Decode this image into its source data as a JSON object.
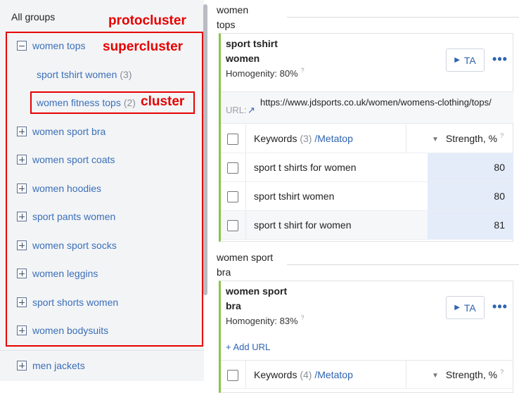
{
  "sidebar": {
    "title": "All groups",
    "labels": {
      "protocluster": "protocluster",
      "supercluster": "supercluster",
      "cluster": "cluster"
    },
    "supercluster": {
      "name": "women tops",
      "icon": "minus-icon"
    },
    "subclusters": [
      {
        "name": "sport tshirt women",
        "count": "(3)"
      },
      {
        "name": "women fitness tops",
        "count": "(2)"
      }
    ],
    "groups": [
      "women sport bra",
      "women sport coats",
      "women hoodies",
      "sport pants women",
      "women sport socks",
      "women leggins",
      "sport shorts women",
      "women bodysuits"
    ],
    "outside_groups": [
      "men jackets"
    ]
  },
  "main": {
    "groups": [
      {
        "title_lines": [
          "women",
          "tops"
        ],
        "card": {
          "title_lines": [
            "sport tshirt",
            "women"
          ],
          "homogeneity": "Homogenity: 80%",
          "ta_label": "TA",
          "url_label": "URL:",
          "url": "https://www.jdsports.co.uk/women/womens-clothing/tops/",
          "table": {
            "keywords_label": "Keywords",
            "keywords_count": "(3)",
            "metatop_label": "/Metatop",
            "strength_label": "Strength, %",
            "rows": [
              {
                "keyword": "sport t shirts for women",
                "strength": "80"
              },
              {
                "keyword": "sport tshirt women",
                "strength": "80"
              },
              {
                "keyword": "sport t shirt for women",
                "strength": "81"
              }
            ]
          }
        }
      },
      {
        "title_lines": [
          "women sport",
          "bra"
        ],
        "card": {
          "title_lines": [
            "women sport",
            "bra"
          ],
          "homogeneity": "Homogenity: 83%",
          "ta_label": "TA",
          "add_url_label": "+ Add URL",
          "table": {
            "keywords_label": "Keywords",
            "keywords_count": "(4)",
            "metatop_label": "/Metatop",
            "strength_label": "Strength, %"
          }
        }
      }
    ]
  },
  "colors": {
    "accent": "#2f63b0",
    "annotation_red": "#e60000",
    "card_border_green": "#8bc34a"
  }
}
